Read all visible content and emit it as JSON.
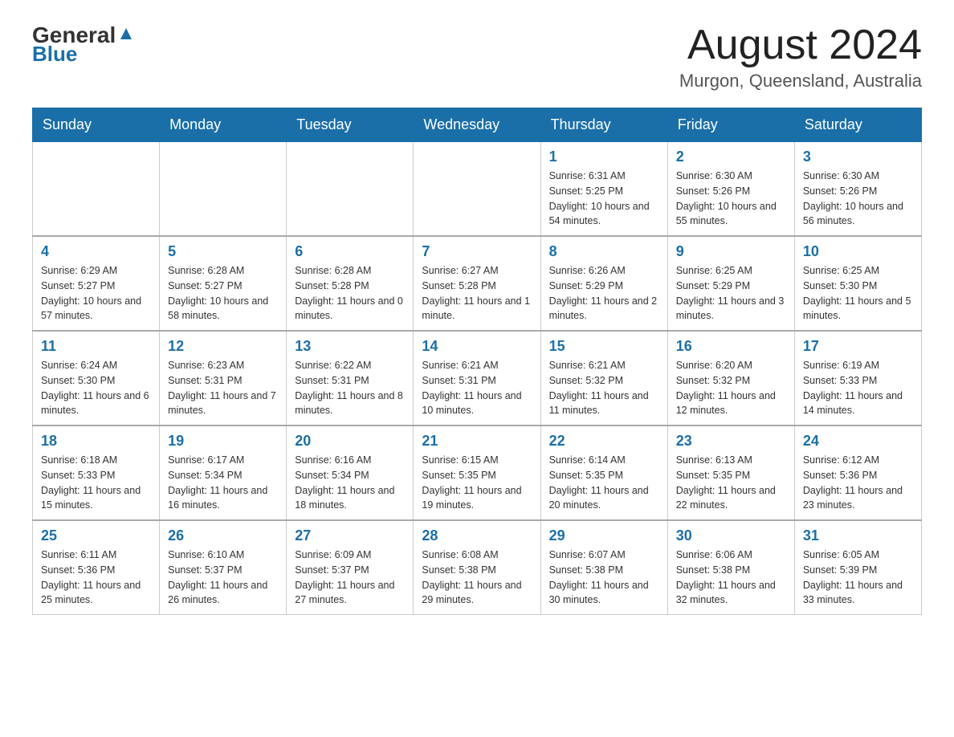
{
  "header": {
    "logo_general": "General",
    "logo_blue": "Blue",
    "month_title": "August 2024",
    "location": "Murgon, Queensland, Australia"
  },
  "days_of_week": [
    "Sunday",
    "Monday",
    "Tuesday",
    "Wednesday",
    "Thursday",
    "Friday",
    "Saturday"
  ],
  "weeks": [
    {
      "days": [
        {
          "number": "",
          "info": ""
        },
        {
          "number": "",
          "info": ""
        },
        {
          "number": "",
          "info": ""
        },
        {
          "number": "",
          "info": ""
        },
        {
          "number": "1",
          "info": "Sunrise: 6:31 AM\nSunset: 5:25 PM\nDaylight: 10 hours and 54 minutes."
        },
        {
          "number": "2",
          "info": "Sunrise: 6:30 AM\nSunset: 5:26 PM\nDaylight: 10 hours and 55 minutes."
        },
        {
          "number": "3",
          "info": "Sunrise: 6:30 AM\nSunset: 5:26 PM\nDaylight: 10 hours and 56 minutes."
        }
      ]
    },
    {
      "days": [
        {
          "number": "4",
          "info": "Sunrise: 6:29 AM\nSunset: 5:27 PM\nDaylight: 10 hours and 57 minutes."
        },
        {
          "number": "5",
          "info": "Sunrise: 6:28 AM\nSunset: 5:27 PM\nDaylight: 10 hours and 58 minutes."
        },
        {
          "number": "6",
          "info": "Sunrise: 6:28 AM\nSunset: 5:28 PM\nDaylight: 11 hours and 0 minutes."
        },
        {
          "number": "7",
          "info": "Sunrise: 6:27 AM\nSunset: 5:28 PM\nDaylight: 11 hours and 1 minute."
        },
        {
          "number": "8",
          "info": "Sunrise: 6:26 AM\nSunset: 5:29 PM\nDaylight: 11 hours and 2 minutes."
        },
        {
          "number": "9",
          "info": "Sunrise: 6:25 AM\nSunset: 5:29 PM\nDaylight: 11 hours and 3 minutes."
        },
        {
          "number": "10",
          "info": "Sunrise: 6:25 AM\nSunset: 5:30 PM\nDaylight: 11 hours and 5 minutes."
        }
      ]
    },
    {
      "days": [
        {
          "number": "11",
          "info": "Sunrise: 6:24 AM\nSunset: 5:30 PM\nDaylight: 11 hours and 6 minutes."
        },
        {
          "number": "12",
          "info": "Sunrise: 6:23 AM\nSunset: 5:31 PM\nDaylight: 11 hours and 7 minutes."
        },
        {
          "number": "13",
          "info": "Sunrise: 6:22 AM\nSunset: 5:31 PM\nDaylight: 11 hours and 8 minutes."
        },
        {
          "number": "14",
          "info": "Sunrise: 6:21 AM\nSunset: 5:31 PM\nDaylight: 11 hours and 10 minutes."
        },
        {
          "number": "15",
          "info": "Sunrise: 6:21 AM\nSunset: 5:32 PM\nDaylight: 11 hours and 11 minutes."
        },
        {
          "number": "16",
          "info": "Sunrise: 6:20 AM\nSunset: 5:32 PM\nDaylight: 11 hours and 12 minutes."
        },
        {
          "number": "17",
          "info": "Sunrise: 6:19 AM\nSunset: 5:33 PM\nDaylight: 11 hours and 14 minutes."
        }
      ]
    },
    {
      "days": [
        {
          "number": "18",
          "info": "Sunrise: 6:18 AM\nSunset: 5:33 PM\nDaylight: 11 hours and 15 minutes."
        },
        {
          "number": "19",
          "info": "Sunrise: 6:17 AM\nSunset: 5:34 PM\nDaylight: 11 hours and 16 minutes."
        },
        {
          "number": "20",
          "info": "Sunrise: 6:16 AM\nSunset: 5:34 PM\nDaylight: 11 hours and 18 minutes."
        },
        {
          "number": "21",
          "info": "Sunrise: 6:15 AM\nSunset: 5:35 PM\nDaylight: 11 hours and 19 minutes."
        },
        {
          "number": "22",
          "info": "Sunrise: 6:14 AM\nSunset: 5:35 PM\nDaylight: 11 hours and 20 minutes."
        },
        {
          "number": "23",
          "info": "Sunrise: 6:13 AM\nSunset: 5:35 PM\nDaylight: 11 hours and 22 minutes."
        },
        {
          "number": "24",
          "info": "Sunrise: 6:12 AM\nSunset: 5:36 PM\nDaylight: 11 hours and 23 minutes."
        }
      ]
    },
    {
      "days": [
        {
          "number": "25",
          "info": "Sunrise: 6:11 AM\nSunset: 5:36 PM\nDaylight: 11 hours and 25 minutes."
        },
        {
          "number": "26",
          "info": "Sunrise: 6:10 AM\nSunset: 5:37 PM\nDaylight: 11 hours and 26 minutes."
        },
        {
          "number": "27",
          "info": "Sunrise: 6:09 AM\nSunset: 5:37 PM\nDaylight: 11 hours and 27 minutes."
        },
        {
          "number": "28",
          "info": "Sunrise: 6:08 AM\nSunset: 5:38 PM\nDaylight: 11 hours and 29 minutes."
        },
        {
          "number": "29",
          "info": "Sunrise: 6:07 AM\nSunset: 5:38 PM\nDaylight: 11 hours and 30 minutes."
        },
        {
          "number": "30",
          "info": "Sunrise: 6:06 AM\nSunset: 5:38 PM\nDaylight: 11 hours and 32 minutes."
        },
        {
          "number": "31",
          "info": "Sunrise: 6:05 AM\nSunset: 5:39 PM\nDaylight: 11 hours and 33 minutes."
        }
      ]
    }
  ]
}
